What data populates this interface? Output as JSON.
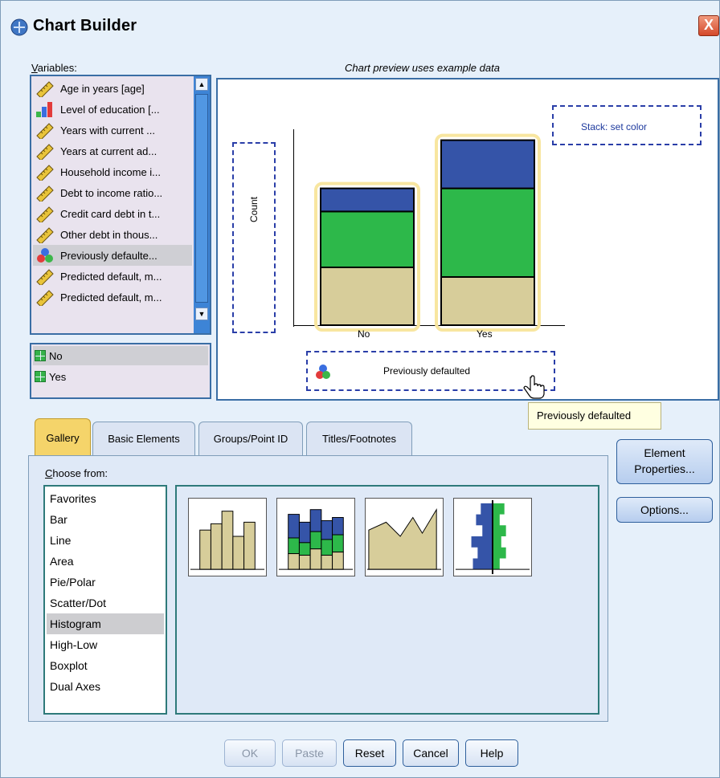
{
  "window": {
    "title": "Chart Builder",
    "close_label": "X"
  },
  "variables": {
    "label_prefix": "V",
    "label_rest": "ariables:",
    "items": [
      {
        "label": "Age in years [age]",
        "icon": "scale-ruler-icon"
      },
      {
        "label": "Level of education [...",
        "icon": "ordinal-bars-icon"
      },
      {
        "label": "Years with current ...",
        "icon": "scale-ruler-icon"
      },
      {
        "label": "Years at current ad...",
        "icon": "scale-ruler-icon"
      },
      {
        "label": "Household income i...",
        "icon": "scale-ruler-icon"
      },
      {
        "label": "Debt to income ratio...",
        "icon": "scale-ruler-icon"
      },
      {
        "label": "Credit card debt in t...",
        "icon": "scale-ruler-icon"
      },
      {
        "label": "Other debt in thous...",
        "icon": "scale-ruler-icon"
      },
      {
        "label": "Previously defaulte...",
        "icon": "nominal-circles-icon",
        "selected": true
      },
      {
        "label": "Predicted default, m...",
        "icon": "scale-ruler-icon"
      },
      {
        "label": "Predicted default, m...",
        "icon": "scale-ruler-icon"
      }
    ]
  },
  "categories": {
    "items": [
      {
        "label": "No",
        "selected": true
      },
      {
        "label": "Yes"
      }
    ]
  },
  "preview": {
    "caption": "Chart preview uses example data",
    "y_dropzone_label": "Count",
    "stack_dropzone_label": "Stack: set color",
    "x_dropzone_label": "Previously defaulted",
    "x_ticks": [
      "No",
      "Yes"
    ]
  },
  "chart_data": {
    "type": "bar",
    "categories": [
      "No",
      "Yes"
    ],
    "series": [
      {
        "color": "#d7cd9a",
        "values": [
          0.3,
          0.25
        ]
      },
      {
        "color": "#2db84a",
        "values": [
          0.29,
          0.46
        ]
      },
      {
        "color": "#3554a8",
        "values": [
          0.12,
          0.25
        ]
      }
    ],
    "ylim": [
      0,
      1
    ]
  },
  "tooltip": {
    "text": "Previously defaulted"
  },
  "tabs": [
    {
      "label": "Gallery",
      "active": true
    },
    {
      "label": "Basic Elements"
    },
    {
      "label": "Groups/Point ID"
    },
    {
      "label": "Titles/Footnotes"
    }
  ],
  "gallery": {
    "choose_prefix": "C",
    "choose_rest": "hoose from:",
    "items": [
      {
        "label": "Favorites"
      },
      {
        "label": "Bar"
      },
      {
        "label": "Line"
      },
      {
        "label": "Area"
      },
      {
        "label": "Pie/Polar"
      },
      {
        "label": "Scatter/Dot"
      },
      {
        "label": "Histogram",
        "selected": true
      },
      {
        "label": "High-Low"
      },
      {
        "label": "Boxplot"
      },
      {
        "label": "Dual Axes"
      }
    ],
    "thumbnails": [
      "simple-histogram-icon",
      "stacked-histogram-icon",
      "frequency-polygon-icon",
      "population-pyramid-icon"
    ]
  },
  "side_buttons": {
    "element_line1": "Element",
    "element_line2": "Properties...",
    "options": "Options..."
  },
  "buttons": {
    "ok": "OK",
    "paste": "Paste",
    "reset": "Reset",
    "cancel": "Cancel",
    "help": "Help"
  },
  "colors": {
    "accent": "#3a6ea5",
    "tab_active": "#f5d46a",
    "highlight_glow": "#f8e6a0"
  }
}
